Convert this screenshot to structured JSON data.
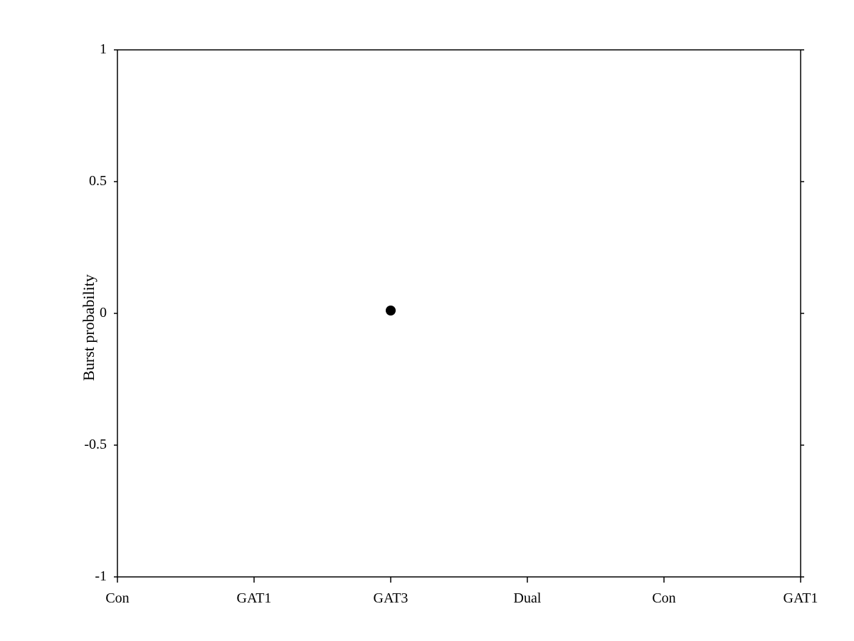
{
  "chart": {
    "title": "",
    "y_axis_label": "Burst probability",
    "x_labels": [
      "Con",
      "GAT1",
      "GAT3",
      "Dual",
      "Con",
      "GAT1"
    ],
    "y_ticks": [
      "1",
      "0.5",
      "0",
      "-0.5",
      "-1"
    ],
    "y_min": -1,
    "y_max": 1,
    "data_points": [
      {
        "x_index": 2,
        "y": 0.01,
        "label": "GAT3"
      }
    ],
    "colors": {
      "axis": "#000000",
      "grid": "#000000",
      "point": "#000000",
      "background": "#ffffff"
    }
  }
}
